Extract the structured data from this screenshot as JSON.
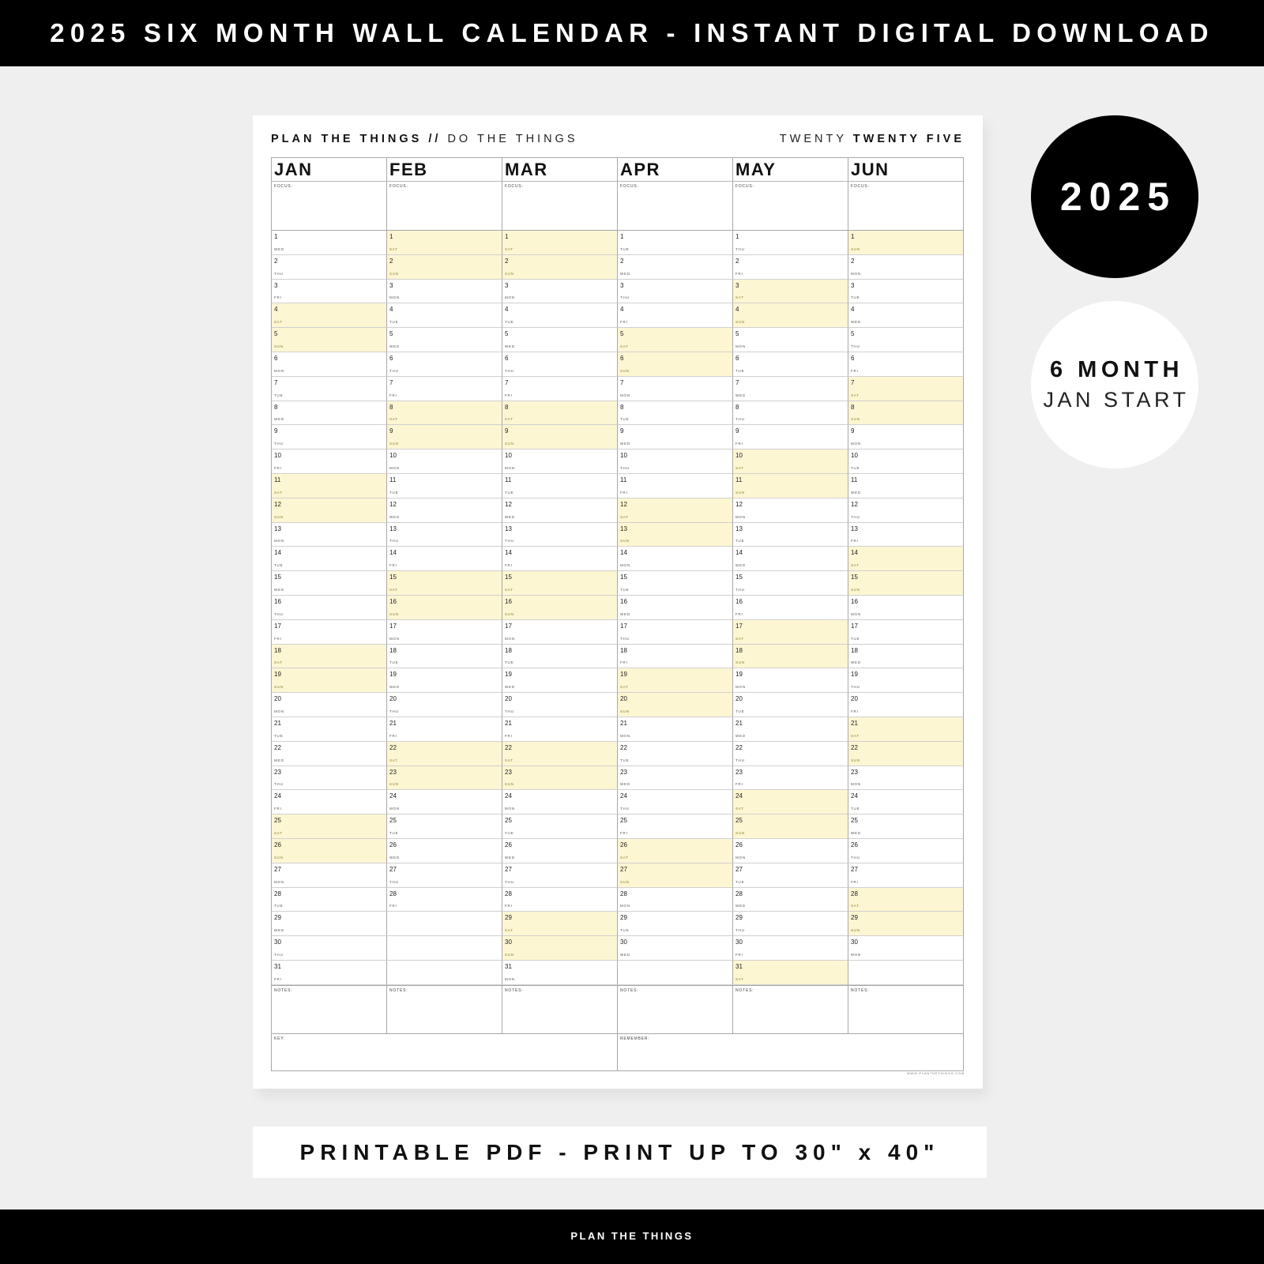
{
  "banner": {
    "title": "2025 SIX MONTH WALL CALENDAR - INSTANT DIGITAL DOWNLOAD"
  },
  "calendar": {
    "tagline_bold": "PLAN THE THINGS //",
    "tagline_light": "DO THE THINGS",
    "year_light": "TWENTY",
    "year_bold": "TWENTY FIVE",
    "focus_label": "FOCUS:",
    "notes_label": "NOTES:",
    "key_label": "KEY:",
    "remember_label": "REMEMBER:",
    "website": "WWW.PLANTHETHINGS.COM",
    "weekend_color": "#fdf6d2",
    "months": [
      {
        "name": "JAN",
        "days": 31,
        "first_weekday": 3
      },
      {
        "name": "FEB",
        "days": 28,
        "first_weekday": 6
      },
      {
        "name": "MAR",
        "days": 31,
        "first_weekday": 6
      },
      {
        "name": "APR",
        "days": 30,
        "first_weekday": 2
      },
      {
        "name": "MAY",
        "days": 31,
        "first_weekday": 4
      },
      {
        "name": "JUN",
        "days": 30,
        "first_weekday": 0
      }
    ],
    "weekday_names": [
      "SUN",
      "MON",
      "TUE",
      "WED",
      "THU",
      "FRI",
      "SAT"
    ]
  },
  "badges": {
    "year": "2025",
    "months_line1": "6 MONTH",
    "months_line2": "JAN START"
  },
  "print_strip": {
    "text": "PRINTABLE PDF - PRINT UP TO 30\" x 40\""
  },
  "footer": {
    "brand": "PLAN THE THINGS"
  }
}
